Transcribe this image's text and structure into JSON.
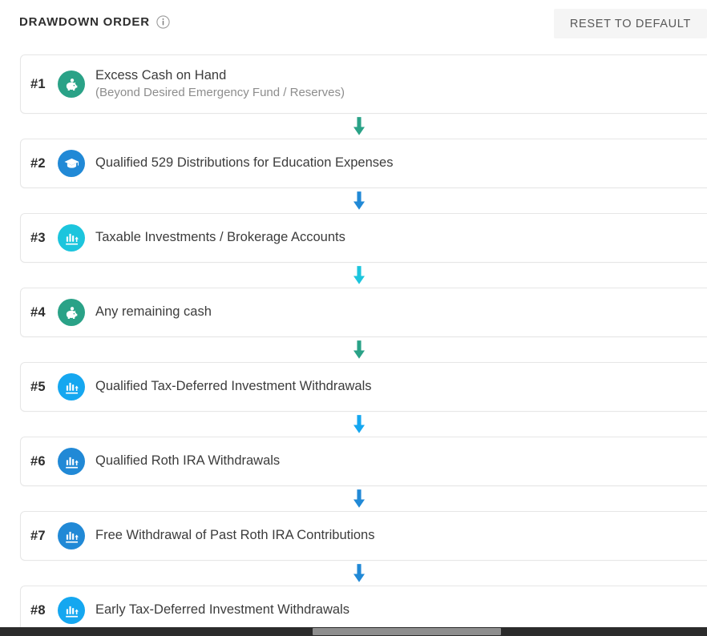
{
  "header": {
    "title": "DRAWDOWN ORDER",
    "info_icon": "info-circle-icon",
    "reset_label": "RESET TO DEFAULT"
  },
  "colors": {
    "teal": "#2aa287",
    "blue": "#2189d6",
    "cyan": "#1cc5dd",
    "dodger": "#15a7f0",
    "card_border": "#e6e6e6",
    "title_text": "#2e2e2e",
    "sub_text": "#8d8d8d",
    "button_bg": "#f5f5f5"
  },
  "rows": [
    {
      "rank": "#1",
      "title": "Excess Cash on Hand",
      "subtitle": "(Beyond Desired Emergency Fund / Reserves)",
      "icon": "piggy-bank-icon",
      "color": "#2aa287"
    },
    {
      "rank": "#2",
      "title": "Qualified 529 Distributions for Education Expenses",
      "subtitle": "",
      "icon": "graduation-cap-icon",
      "color": "#2189d6"
    },
    {
      "rank": "#3",
      "title": "Taxable Investments / Brokerage Accounts",
      "subtitle": "",
      "icon": "growth-chart-icon",
      "color": "#1cc5dd"
    },
    {
      "rank": "#4",
      "title": "Any remaining cash",
      "subtitle": "",
      "icon": "piggy-bank-icon",
      "color": "#2aa287"
    },
    {
      "rank": "#5",
      "title": "Qualified Tax-Deferred Investment Withdrawals",
      "subtitle": "",
      "icon": "growth-chart-icon",
      "color": "#15a7f0"
    },
    {
      "rank": "#6",
      "title": "Qualified Roth IRA Withdrawals",
      "subtitle": "",
      "icon": "growth-chart-icon",
      "color": "#2189d6"
    },
    {
      "rank": "#7",
      "title": "Free Withdrawal of Past Roth IRA Contributions",
      "subtitle": "",
      "icon": "growth-chart-icon",
      "color": "#2189d6"
    },
    {
      "rank": "#8",
      "title": "Early Tax-Deferred Investment Withdrawals",
      "subtitle": "",
      "icon": "growth-chart-icon",
      "color": "#15a7f0"
    }
  ],
  "connectors": [
    {
      "icon": "arrow-down-icon",
      "color": "#2aa287"
    },
    {
      "icon": "arrow-down-icon",
      "color": "#2189d6"
    },
    {
      "icon": "arrow-down-icon",
      "color": "#1cc5dd"
    },
    {
      "icon": "arrow-down-icon",
      "color": "#2aa287"
    },
    {
      "icon": "arrow-down-icon",
      "color": "#15a7f0"
    },
    {
      "icon": "arrow-down-icon",
      "color": "#2189d6"
    },
    {
      "icon": "arrow-down-icon",
      "color": "#2189d6"
    }
  ],
  "scrollbar": {
    "orientation": "horizontal"
  }
}
